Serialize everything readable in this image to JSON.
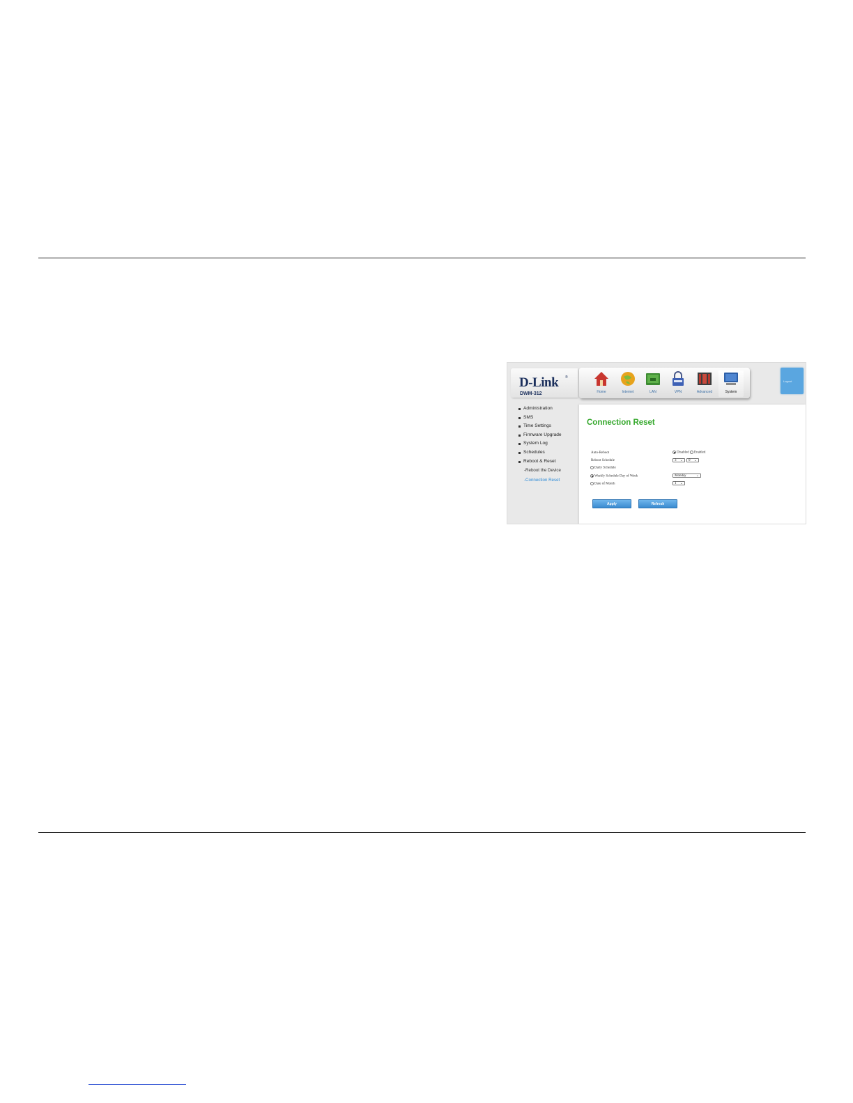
{
  "header": {
    "logo_text": "D-Link",
    "logo_registered": "®",
    "model": "DWM-312"
  },
  "nav": [
    {
      "label": "Home",
      "icon": "home-icon"
    },
    {
      "label": "Internet",
      "icon": "globe-icon"
    },
    {
      "label": "LAN",
      "icon": "lan-icon"
    },
    {
      "label": "VPN",
      "icon": "lock-icon"
    },
    {
      "label": "Advanced",
      "icon": "advanced-icon"
    },
    {
      "label": "System",
      "icon": "monitor-icon"
    }
  ],
  "logout_label": "Logout",
  "sidebar": {
    "items": [
      {
        "label": "Administration"
      },
      {
        "label": "SMS"
      },
      {
        "label": "Time Settings"
      },
      {
        "label": "Firmware Upgrade"
      },
      {
        "label": "System Log"
      },
      {
        "label": "Schedules"
      },
      {
        "label": "Reboot & Reset"
      }
    ],
    "subitems": [
      {
        "label": "-Reboot the Device"
      },
      {
        "label": "-Connection Reset"
      }
    ]
  },
  "page": {
    "title": "Connection Reset",
    "auto_reboot_label": "Auto-Reboot",
    "disabled_label": "Disabled",
    "enabled_label": "Enabled",
    "reboot_schedule_label": "Reboot Schedule",
    "reboot_hour": "3",
    "reboot_minute": "0",
    "daily_schedule_label": "Daily Schedule",
    "weekly_schedule_label": "Weekly Schedule Day of Week",
    "weekly_day": "Monday",
    "date_of_month_label": "Date of Month",
    "date_of_month": "1",
    "apply_label": "Apply",
    "refresh_label": "Refresh"
  },
  "colors": {
    "title_green": "#35a82c",
    "active_link_blue": "#2c8ad6",
    "button_blue": "#4a9ad9"
  }
}
